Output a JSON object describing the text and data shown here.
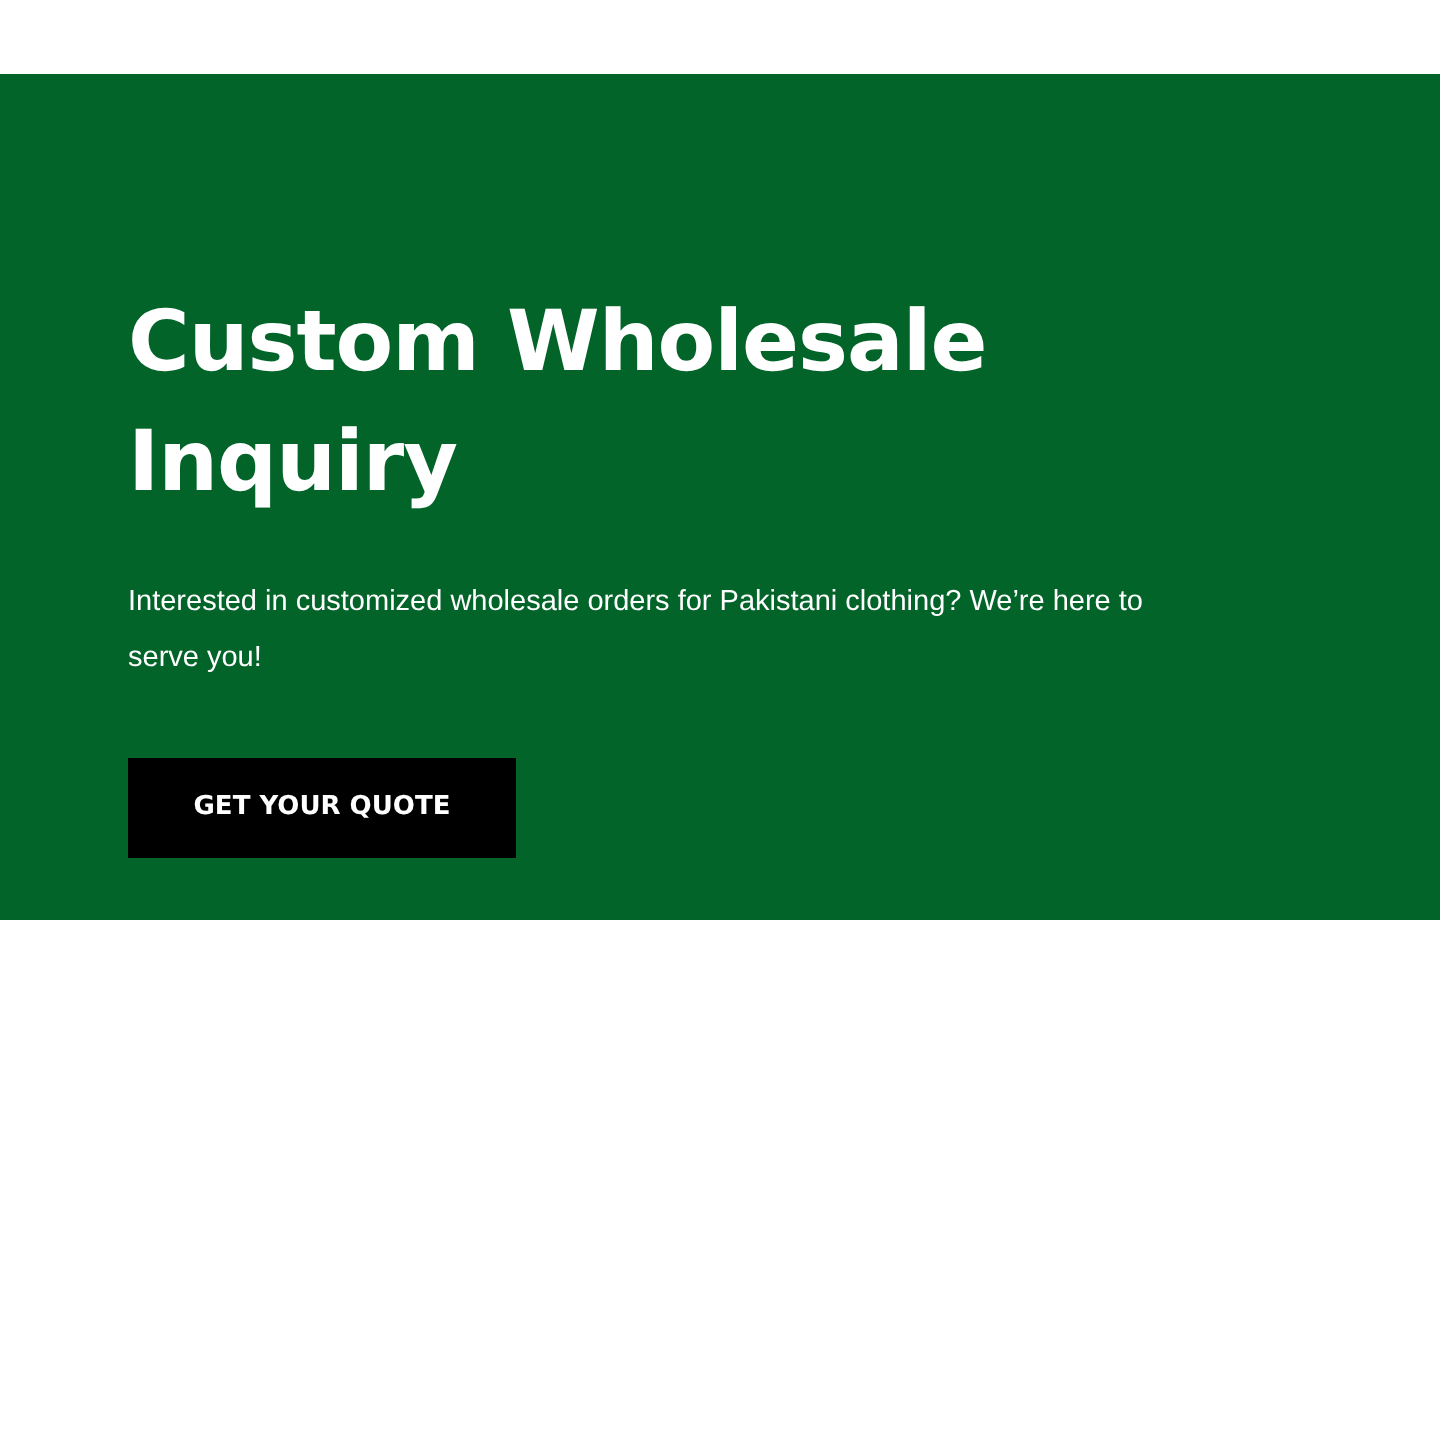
{
  "hero": {
    "title": "Custom Wholesale Inquiry",
    "description": "Interested in customized wholesale orders for Pakistani clothing? We’re here to serve you!",
    "button": "GET YOUR QUOTE"
  }
}
